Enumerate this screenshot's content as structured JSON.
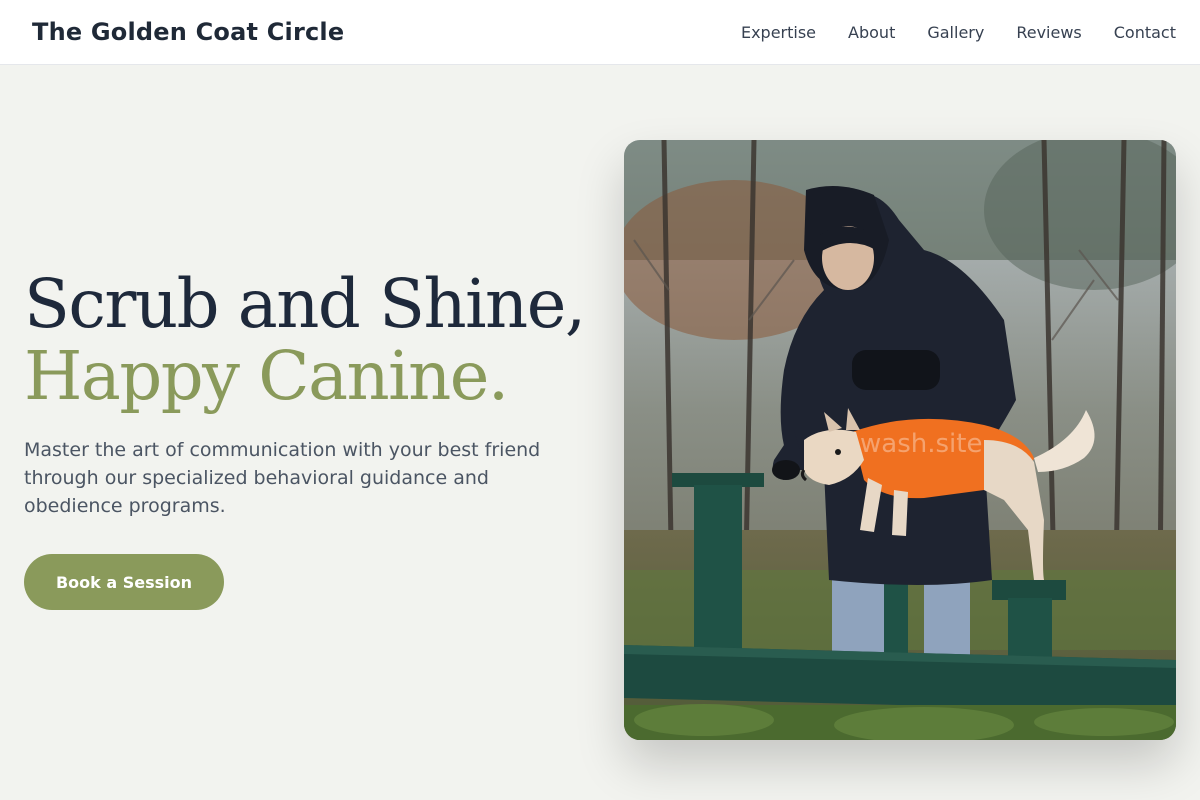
{
  "brand": {
    "name": "The Golden Coat Circle"
  },
  "nav": {
    "links": [
      {
        "label": "Expertise"
      },
      {
        "label": "About"
      },
      {
        "label": "Gallery"
      },
      {
        "label": "Reviews"
      },
      {
        "label": "Contact"
      }
    ]
  },
  "hero": {
    "headline_line1": "Scrub and Shine,",
    "headline_line2": "Happy Canine.",
    "subtitle": "Master the art of communication with your best friend through our specialized behavioral guidance and obedience programs.",
    "cta_label": "Book a Session",
    "image_watermark": "wash.site"
  },
  "colors": {
    "accent": "#8a9a5b",
    "page_background": "#f2f3ef",
    "heading": "#1e293b",
    "body_text": "#4b5563"
  }
}
